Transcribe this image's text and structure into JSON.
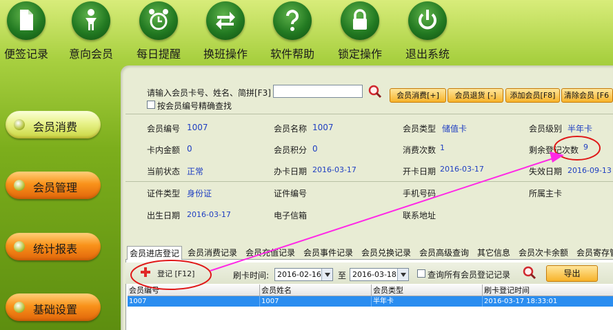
{
  "toolbar": {
    "items": [
      {
        "label": "便签记录",
        "icon": "note-icon"
      },
      {
        "label": "意向会员",
        "icon": "person-icon"
      },
      {
        "label": "每日提醒",
        "icon": "alarm-clock-icon"
      },
      {
        "label": "换班操作",
        "icon": "swap-arrows-icon"
      },
      {
        "label": "软件帮助",
        "icon": "question-mark-icon"
      },
      {
        "label": "锁定操作",
        "icon": "lock-icon"
      },
      {
        "label": "退出系统",
        "icon": "power-icon"
      }
    ]
  },
  "sidebar": {
    "items": [
      {
        "label": "会员消费"
      },
      {
        "label": "会员管理"
      },
      {
        "label": "统计报表"
      },
      {
        "label": "基础设置"
      }
    ]
  },
  "search": {
    "label": "请输入会员卡号、姓名、简拼[F3]",
    "value": "",
    "exact_label": "按会员编号精确查找"
  },
  "actions": {
    "consume": "会员消费[+]",
    "return": "会员退货 [-]",
    "add": "添加会员[F8]",
    "clear": "清除会员 [F6"
  },
  "member": {
    "id_label": "会员编号",
    "id": "1007",
    "name_label": "会员名称",
    "name": "1007",
    "type_label": "会员类型",
    "type": "储值卡",
    "level_label": "会员级别",
    "level": "半年卡",
    "balance_label": "卡内金额",
    "balance": "0",
    "points_label": "会员积分",
    "points": "0",
    "visits_label": "消费次数",
    "visits": "1",
    "remaining_label": "剩余登记次数",
    "remaining": "9",
    "status_label": "当前状态",
    "status": "正常",
    "apply_date_label": "办卡日期",
    "apply_date": "2016-03-17",
    "open_date_label": "开卡日期",
    "open_date": "2016-03-17",
    "expire_date_label": "失效日期",
    "expire_date": "2016-09-13",
    "cert_type_label": "证件类型",
    "cert_type": "身份证",
    "cert_no_label": "证件编号",
    "phone_label": "手机号码",
    "main_card_label": "所属主卡",
    "birth_label": "出生日期",
    "birth": "2016-03-17",
    "email_label": "电子信箱",
    "address_label": "联系地址"
  },
  "tabs": [
    "会员进店登记",
    "会员消费记录",
    "会员充值记录",
    "会员事件记录",
    "会员兑换记录",
    "会员高级查询",
    "其它信息",
    "会员次卡余额",
    "会员寄存管"
  ],
  "subtoolbar": {
    "register_label": "登记 [F12]",
    "time_label": "刷卡时间:",
    "from_date": "2016-02-16",
    "to_label": "至",
    "to_date": "2016-03-18",
    "all_label": "查询所有会员登记记录",
    "export_label": "导出"
  },
  "grid": {
    "columns": [
      "会员编号",
      "会员姓名",
      "会员类型",
      "刷卡登记时间"
    ],
    "rows": [
      [
        "1007",
        "1007",
        "半年卡",
        "2016-03-17 18:33:01"
      ]
    ]
  }
}
